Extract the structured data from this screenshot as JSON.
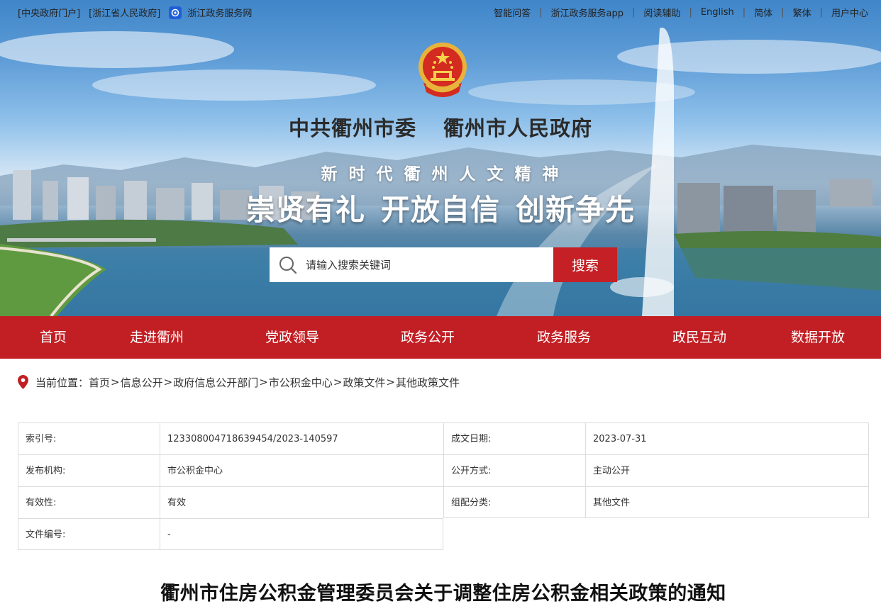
{
  "topbar": {
    "left_links": [
      "[中央政府门户]",
      "[浙江省人民政府]",
      "浙江政务服务网"
    ],
    "right_links": [
      "智能问答",
      "浙江政务服务app",
      "阅读辅助",
      "English",
      "简体",
      "繁体",
      "用户中心"
    ],
    "separator": "|"
  },
  "header": {
    "title_party": "中共衢州市委",
    "title_gov": "衢州市人民政府",
    "slogan_top": "新时代衢州人文精神",
    "slogan_parts": [
      "崇贤有礼",
      "开放自信",
      "创新争先"
    ]
  },
  "search": {
    "placeholder": "请输入搜索关键词",
    "button_label": "搜索"
  },
  "nav": {
    "items": [
      "首页",
      "走进衢州",
      "党政领导",
      "政务公开",
      "政务服务",
      "政民互动",
      "数据开放"
    ]
  },
  "breadcrumb": {
    "label": "当前位置：",
    "items": [
      "首页",
      "信息公开",
      "政府信息公开部门",
      "市公积金中心",
      "政策文件",
      "其他政策文件"
    ],
    "separator": ">"
  },
  "meta": {
    "index_label": "索引号:",
    "index_value": "123308004718639454/2023-140597",
    "date_label": "成文日期:",
    "date_value": "2023-07-31",
    "org_label": "发布机构:",
    "org_value": "市公积金中心",
    "mode_label": "公开方式:",
    "mode_value": "主动公开",
    "valid_label": "有效性:",
    "valid_value": "有效",
    "category_label": "组配分类:",
    "category_value": "其他文件",
    "docno_label": "文件编号:",
    "docno_value": "-"
  },
  "article": {
    "title": "衢州市住房公积金管理委员会关于调整住房公积金相关政策的通知"
  },
  "colors": {
    "brand_red": "#c21f24",
    "search_red": "#c42025",
    "table_border": "#dcdcdc"
  }
}
